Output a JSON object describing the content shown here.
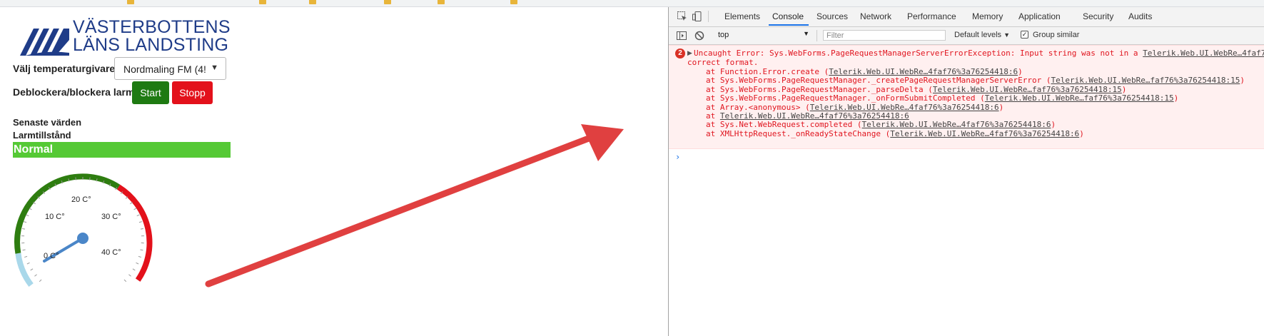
{
  "page": {
    "logo": {
      "line1": "VÄSTERBOTTENS",
      "line2": "LÄNS LANDSTING",
      "brand_color": "#1f3c88"
    },
    "sensor_label": "Välj temperaturgivare",
    "sensor_select": {
      "value": "Nordmaling FM (4!"
    },
    "alarm_label": "Deblockera/blockera larm",
    "start_button": "Start",
    "stop_button": "Stopp",
    "latest_values_label": "Senaste värden",
    "alarm_state_label": "Larmtillstånd",
    "alarm_state_value": "Normal",
    "gauge": {
      "ticks": [
        "0 C°",
        "10 C°",
        "20 C°",
        "30 C°",
        "40 C°"
      ],
      "colors": {
        "cold": "#a9d8ea",
        "normal": "#2e7d10",
        "hot": "#e3111b",
        "needle": "#4a86c8"
      }
    }
  },
  "devtools": {
    "tabs": [
      "Elements",
      "Console",
      "Sources",
      "Network",
      "Performance",
      "Memory",
      "Application",
      "Security",
      "Audits"
    ],
    "active_tab": "Console",
    "toolbar": {
      "context": "top",
      "filter_placeholder": "Filter",
      "levels": "Default levels",
      "group_similar": "Group similar",
      "group_similar_checked": "✓"
    },
    "error": {
      "count": "2",
      "message_line1": "Uncaught Error: Sys.WebForms.PageRequestManagerServerErrorException: Input string was not in a ",
      "message_link": "Telerik.Web.UI.WebRe…4faf7",
      "message_line2": "correct format.",
      "stack": [
        {
          "text": "at Function.Error.create (",
          "link": "Telerik.Web.UI.WebRe…4faf76%3a76254418:6",
          "close": ")"
        },
        {
          "text": "at Sys.WebForms.PageRequestManager._createPageRequestManagerServerError (",
          "link": "Telerik.Web.UI.WebRe…faf76%3a76254418:15",
          "close": ")"
        },
        {
          "text": "at Sys.WebForms.PageRequestManager._parseDelta (",
          "link": "Telerik.Web.UI.WebRe…faf76%3a76254418:15",
          "close": ")"
        },
        {
          "text": "at Sys.WebForms.PageRequestManager._onFormSubmitCompleted (",
          "link": "Telerik.Web.UI.WebRe…faf76%3a76254418:15",
          "close": ")"
        },
        {
          "text": "at Array.<anonymous> (",
          "link": "Telerik.Web.UI.WebRe…4faf76%3a76254418:6",
          "close": ")"
        },
        {
          "text": "at ",
          "link": "Telerik.Web.UI.WebRe…4faf76%3a76254418:6",
          "close": ""
        },
        {
          "text": "at Sys.Net.WebRequest.completed (",
          "link": "Telerik.Web.UI.WebRe…4faf76%3a76254418:6",
          "close": ")"
        },
        {
          "text": "at XMLHttpRequest._onReadyStateChange (",
          "link": "Telerik.Web.UI.WebRe…4faf76%3a76254418:6",
          "close": ")"
        }
      ],
      "color": "#e0151f"
    },
    "prompt_symbol": "›"
  },
  "annotation": {
    "arrow_color": "#e04040"
  }
}
